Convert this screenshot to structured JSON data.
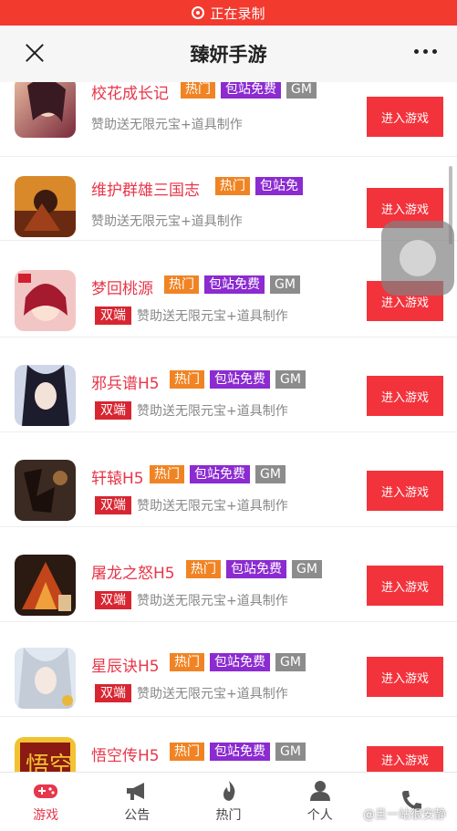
{
  "recording": {
    "label": "正在录制"
  },
  "header": {
    "title": "臻妍手游"
  },
  "games": [
    {
      "name": "校花成长记",
      "hot": "热门",
      "free": "包站免费",
      "gm": "GM",
      "dual": "",
      "desc": "赞助送无限元宝+道具制作",
      "button": "进入游戏"
    },
    {
      "name": "维护群雄三国志",
      "hot": "热门",
      "free": "包站免",
      "gm": "",
      "dual": "",
      "desc": "赞助送无限元宝+道具制作",
      "button": "进入游戏"
    },
    {
      "name": "梦回桃源",
      "hot": "热门",
      "free": "包站免费",
      "gm": "GM",
      "dual": "双端",
      "desc": "赞助送无限元宝+道具制作",
      "button": "进入游戏"
    },
    {
      "name": "邪兵谱H5",
      "hot": "热门",
      "free": "包站免费",
      "gm": "GM",
      "dual": "双端",
      "desc": "赞助送无限元宝+道具制作",
      "button": "进入游戏"
    },
    {
      "name": "轩辕H5",
      "hot": "热门",
      "free": "包站免费",
      "gm": "GM",
      "dual": "双端",
      "desc": "赞助送无限元宝+道具制作",
      "button": "进入游戏"
    },
    {
      "name": "屠龙之怒H5",
      "hot": "热门",
      "free": "包站免费",
      "gm": "GM",
      "dual": "双端",
      "desc": "赞助送无限元宝+道具制作",
      "button": "进入游戏"
    },
    {
      "name": "星辰诀H5",
      "hot": "热门",
      "free": "包站免费",
      "gm": "GM",
      "dual": "双端",
      "desc": "赞助送无限元宝+道具制作",
      "button": "进入游戏"
    },
    {
      "name": "悟空传H5",
      "hot": "热门",
      "free": "包站免费",
      "gm": "GM",
      "dual": "",
      "desc": "",
      "button": "进入游戏"
    }
  ],
  "tabbar": {
    "items": [
      {
        "label": "游戏",
        "icon": "gamepad-icon"
      },
      {
        "label": "公告",
        "icon": "megaphone-icon"
      },
      {
        "label": "热门",
        "icon": "flame-icon"
      },
      {
        "label": "个人",
        "icon": "user-icon"
      },
      {
        "label": "",
        "icon": "phone-icon"
      }
    ]
  },
  "watermark": "@旦一站很安静",
  "colors": {
    "accent": "#f2333c",
    "hot_tag": "#f08424",
    "free_tag": "#8b2bd0",
    "gm_tag": "#8c8c8c",
    "title_red": "#e8364a"
  }
}
